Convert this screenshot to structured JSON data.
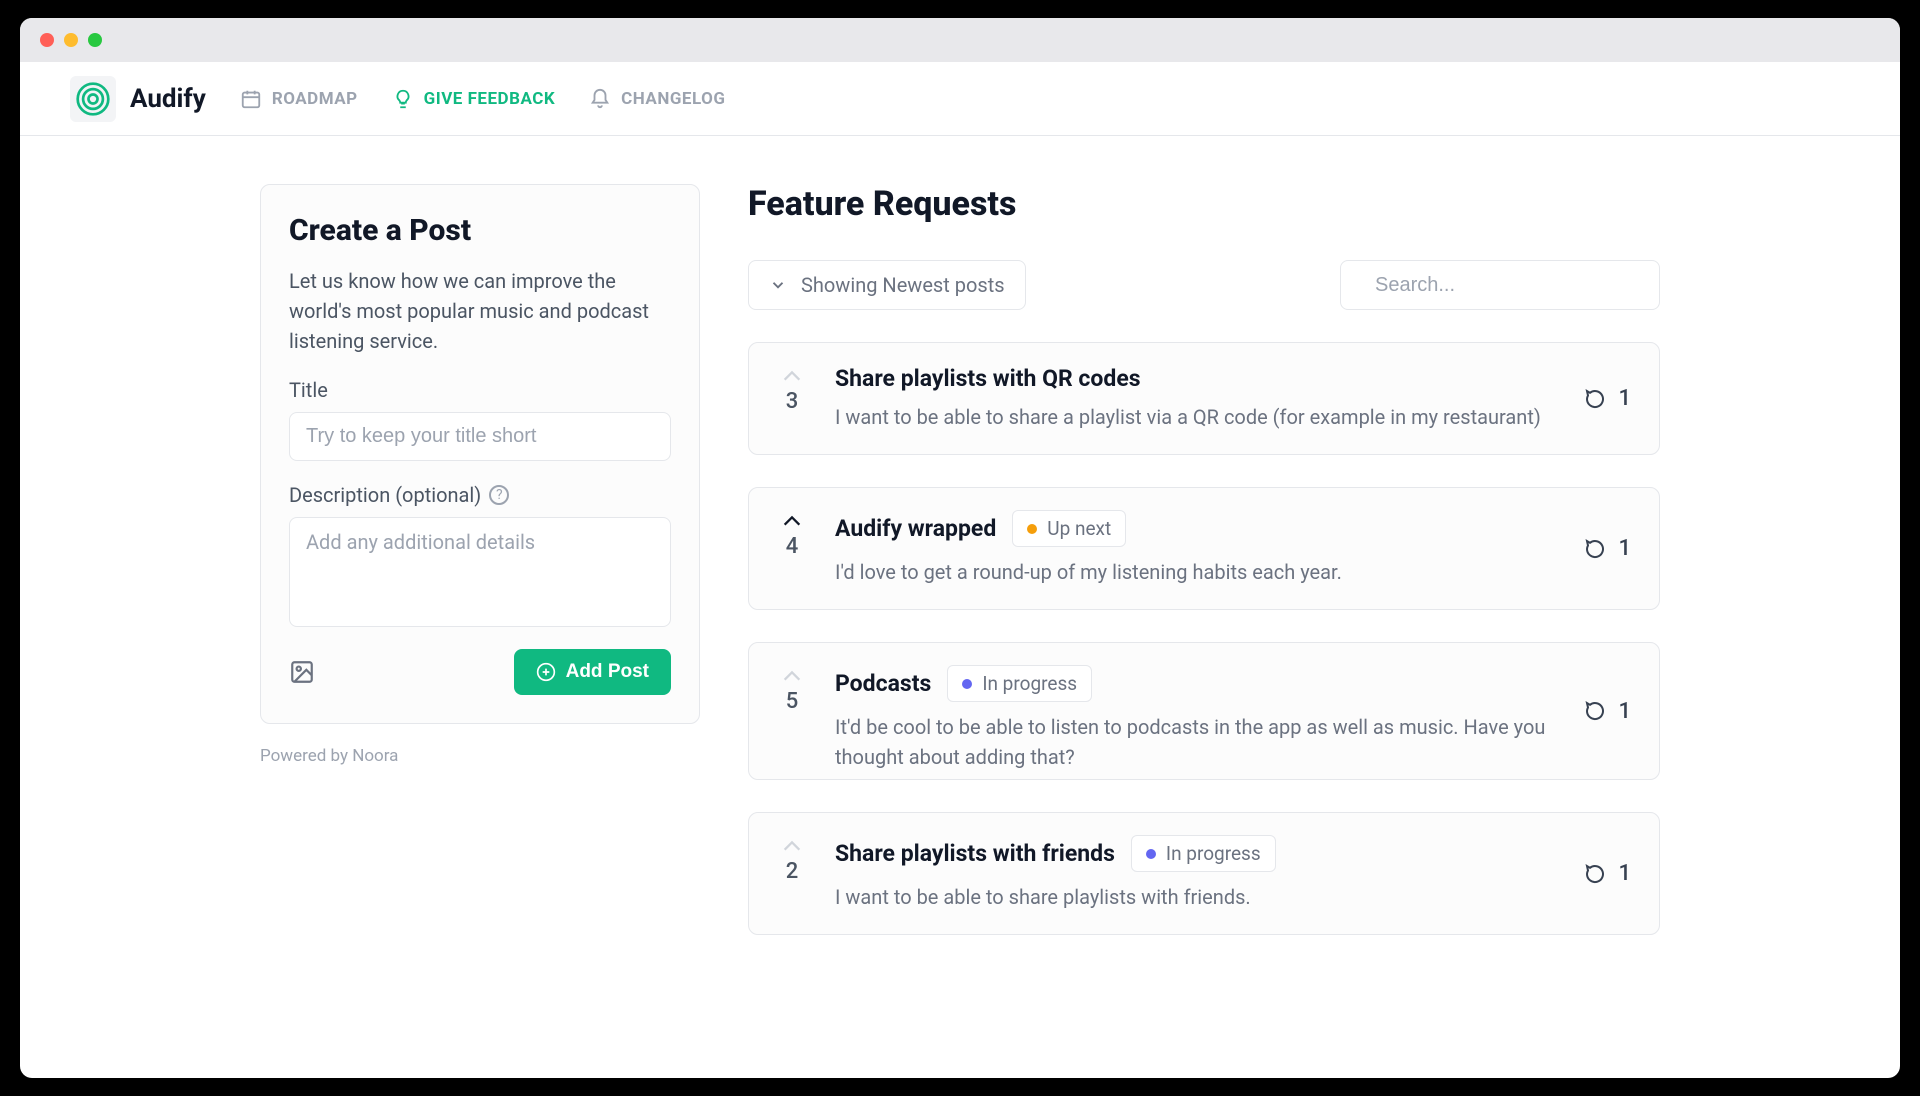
{
  "brand": "Audify",
  "nav": {
    "roadmap": "ROADMAP",
    "feedback": "GIVE FEEDBACK",
    "changelog": "CHANGELOG"
  },
  "sidebar": {
    "title": "Create a Post",
    "description": "Let us know how we can improve the world's most popular music and podcast listening service.",
    "title_label": "Title",
    "title_placeholder": "Try to keep your title short",
    "desc_label": "Description (optional)",
    "desc_placeholder": "Add any additional details",
    "submit_label": "Add Post",
    "powered": "Powered by Noora"
  },
  "main": {
    "title": "Feature Requests",
    "sort_label": "Showing Newest posts",
    "search_placeholder": "Search..."
  },
  "posts": [
    {
      "votes": "3",
      "voted": false,
      "title": "Share playlists with QR codes",
      "desc": "I want to be able to share a playlist via a QR code (for example in my restaurant)",
      "comments": "1",
      "status": null
    },
    {
      "votes": "4",
      "voted": true,
      "title": "Audify wrapped",
      "desc": "I'd love to get a round-up of my listening habits each year.",
      "comments": "1",
      "status": {
        "label": "Up next",
        "color": "orange"
      }
    },
    {
      "votes": "5",
      "voted": false,
      "title": "Podcasts",
      "desc": "It'd be cool to be able to listen to podcasts in the app as well as music. Have you thought about adding that?",
      "comments": "1",
      "status": {
        "label": "In progress",
        "color": "purple"
      }
    },
    {
      "votes": "2",
      "voted": false,
      "title": "Share playlists with friends",
      "desc": "I want to be able to share playlists with friends.",
      "comments": "1",
      "status": {
        "label": "In progress",
        "color": "purple"
      }
    }
  ]
}
